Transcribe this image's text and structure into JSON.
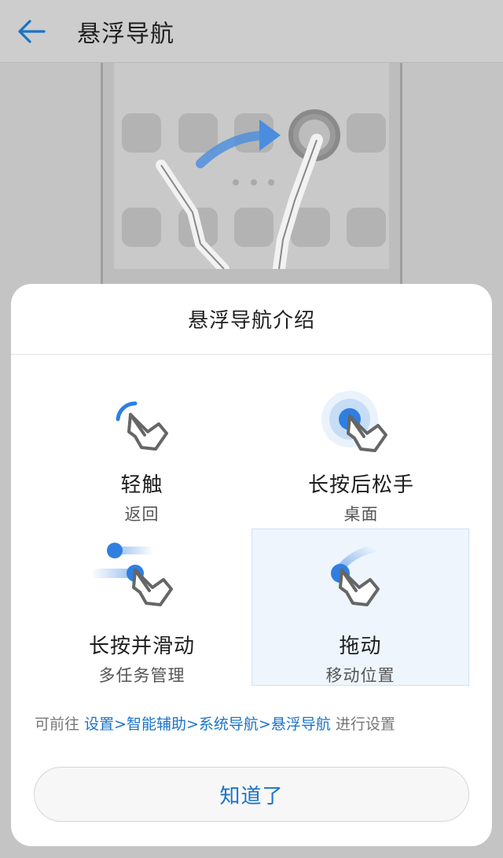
{
  "header": {
    "title": "悬浮导航"
  },
  "dialog": {
    "title": "悬浮导航介绍",
    "gestures": [
      {
        "name": "轻触",
        "desc": "返回",
        "icon": "tap-icon"
      },
      {
        "name": "长按后松手",
        "desc": "桌面",
        "icon": "long-press-icon"
      },
      {
        "name": "长按并滑动",
        "desc": "多任务管理",
        "icon": "long-press-slide-icon"
      },
      {
        "name": "拖动",
        "desc": "移动位置",
        "icon": "drag-icon"
      }
    ],
    "hint": {
      "prefix": "可前往",
      "link": "设置>智能辅助>系统导航>悬浮导航",
      "suffix": "进行设置"
    },
    "ok_label": "知道了"
  },
  "colors": {
    "accent": "#1a73c8",
    "icon_blue": "#2f7fe0",
    "overlay": "#c4c4c4",
    "selected_bg": "#eef5fd"
  }
}
